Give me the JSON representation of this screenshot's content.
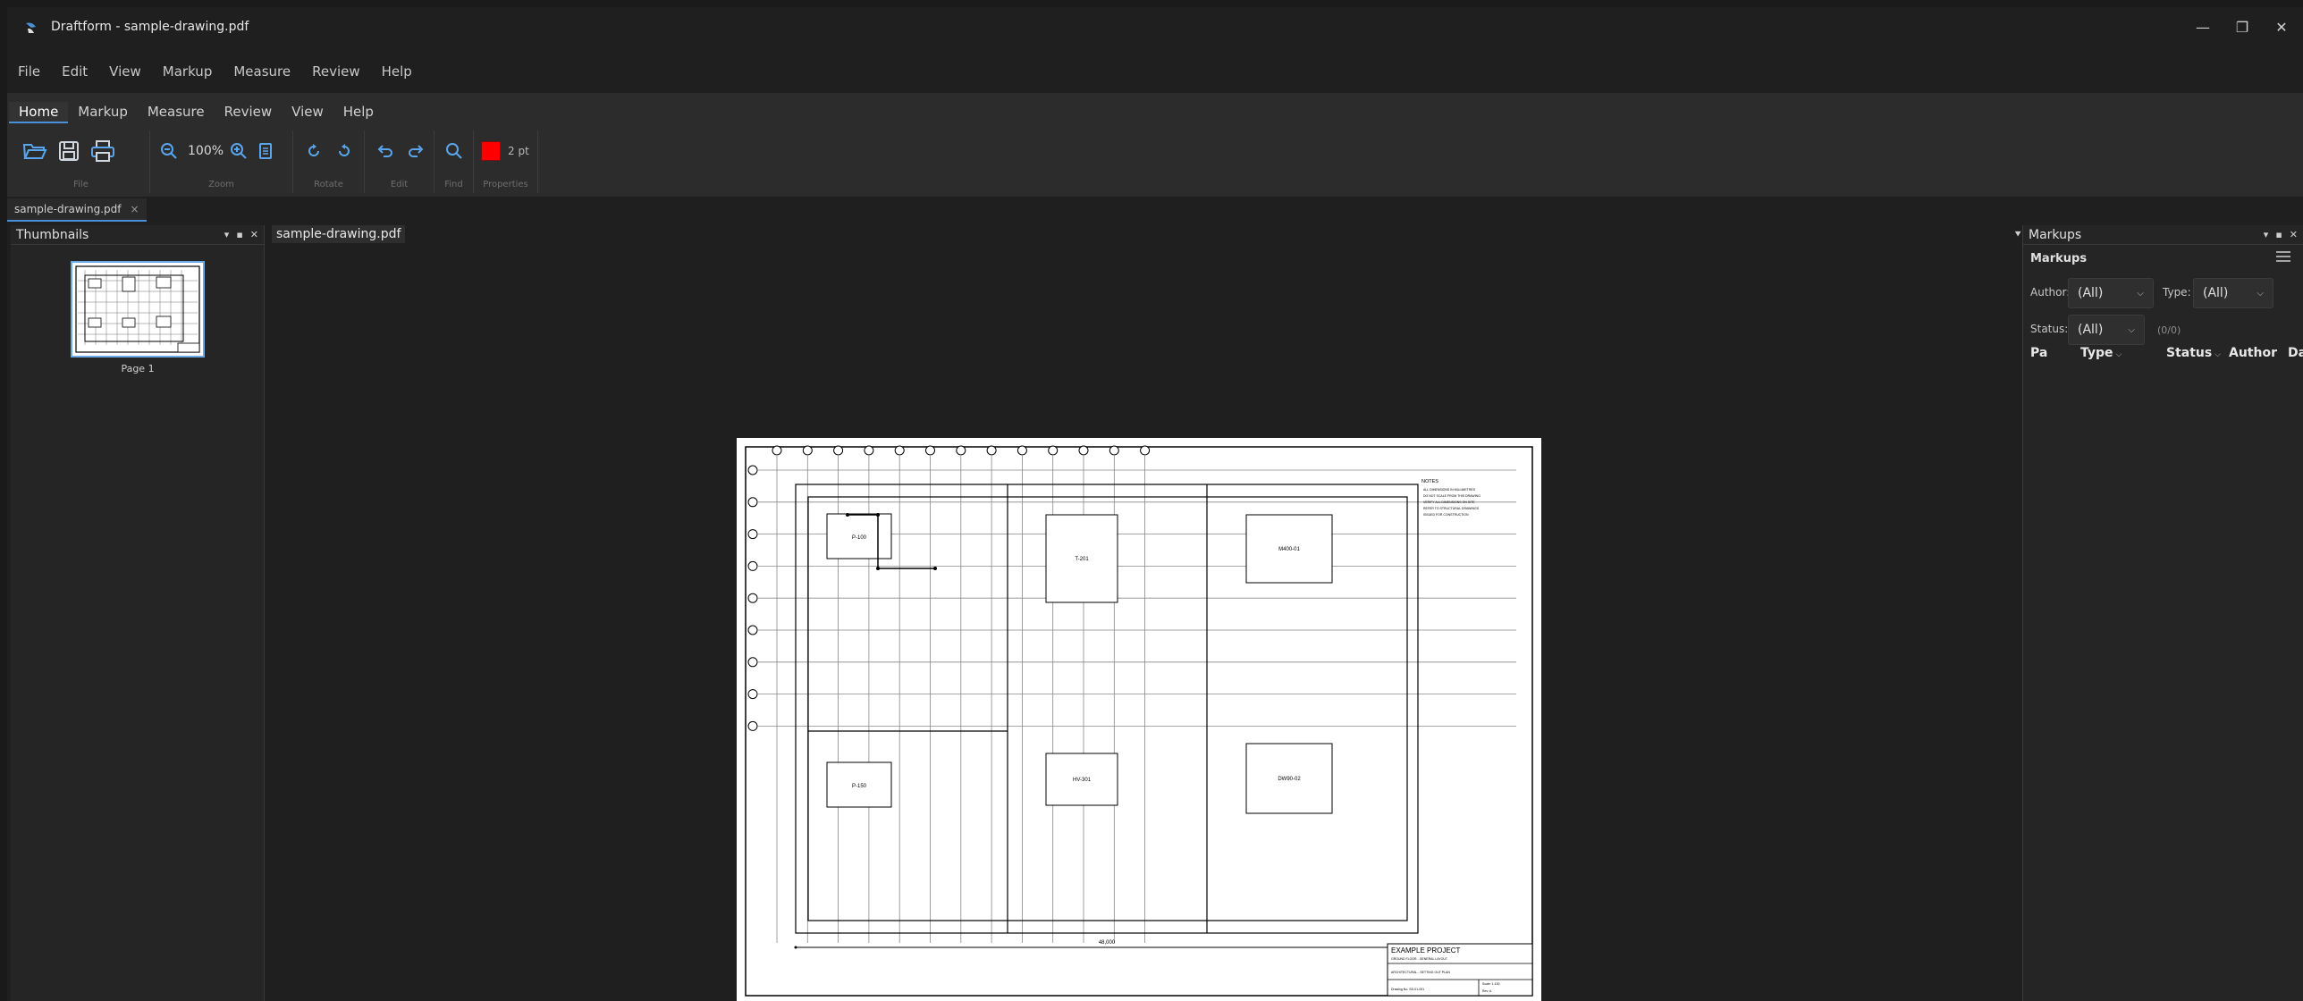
{
  "window": {
    "title": "Draftform - sample-drawing.pdf",
    "minimize_glyph": "—",
    "restore_glyph": "❐",
    "close_glyph": "✕"
  },
  "menubar": [
    "File",
    "Edit",
    "View",
    "Markup",
    "Measure",
    "Review",
    "Help"
  ],
  "ribbon": {
    "tabs": [
      "Home",
      "Markup",
      "Measure",
      "Review",
      "View",
      "Help"
    ],
    "active_tab": "Home",
    "groups": {
      "file": "File",
      "zoom": "Zoom",
      "rotate": "Rotate",
      "edit": "Edit",
      "find": "Find",
      "properties": "Properties"
    },
    "zoom_level": "100%",
    "stroke_width": "2 pt",
    "stroke_color": "#ff0000"
  },
  "document_tab": {
    "name": "sample-drawing.pdf",
    "close_glyph": "×"
  },
  "thumbnails_panel": {
    "title": "Thumbnails",
    "page_label": "Page 1"
  },
  "viewer": {
    "tab_name": "sample-drawing.pdf",
    "menu_glyph": "⯆"
  },
  "drawing": {
    "room_labels": [
      "P-100",
      "T-201",
      "M400-01",
      "P-150",
      "HV-301",
      "DW90-02"
    ],
    "dimension_text": "48,000",
    "notes_title": "NOTES",
    "notes": [
      "ALL DIMENSIONS IN MILLIMETRES",
      "DO NOT SCALE FROM THIS DRAWING",
      "VERIFY ALL DIMENSIONS ON SITE",
      "REFER TO STRUCTURAL DRAWINGS",
      "ISSUED FOR CONSTRUCTION"
    ],
    "title_block": {
      "project": "EXAMPLE PROJECT",
      "line1": "GROUND FLOOR - GENERAL LAYOUT",
      "line2": "ARCHITECTURAL - SETTING OUT PLAN",
      "drawing_no": "Drawing No. SD-01-001",
      "scale": "Scale: 1:100",
      "rev": "Rev: A"
    }
  },
  "markups_panel": {
    "title": "Markups",
    "subtitle": "Markups",
    "author_label": "Author:",
    "author_value": "(All)",
    "type_label": "Type:",
    "type_value": "(All)",
    "status_label": "Status:",
    "status_value": "(All)",
    "count": "(0/0)",
    "columns": [
      "Pa",
      "Type",
      "Status",
      "Author",
      "Da"
    ]
  }
}
